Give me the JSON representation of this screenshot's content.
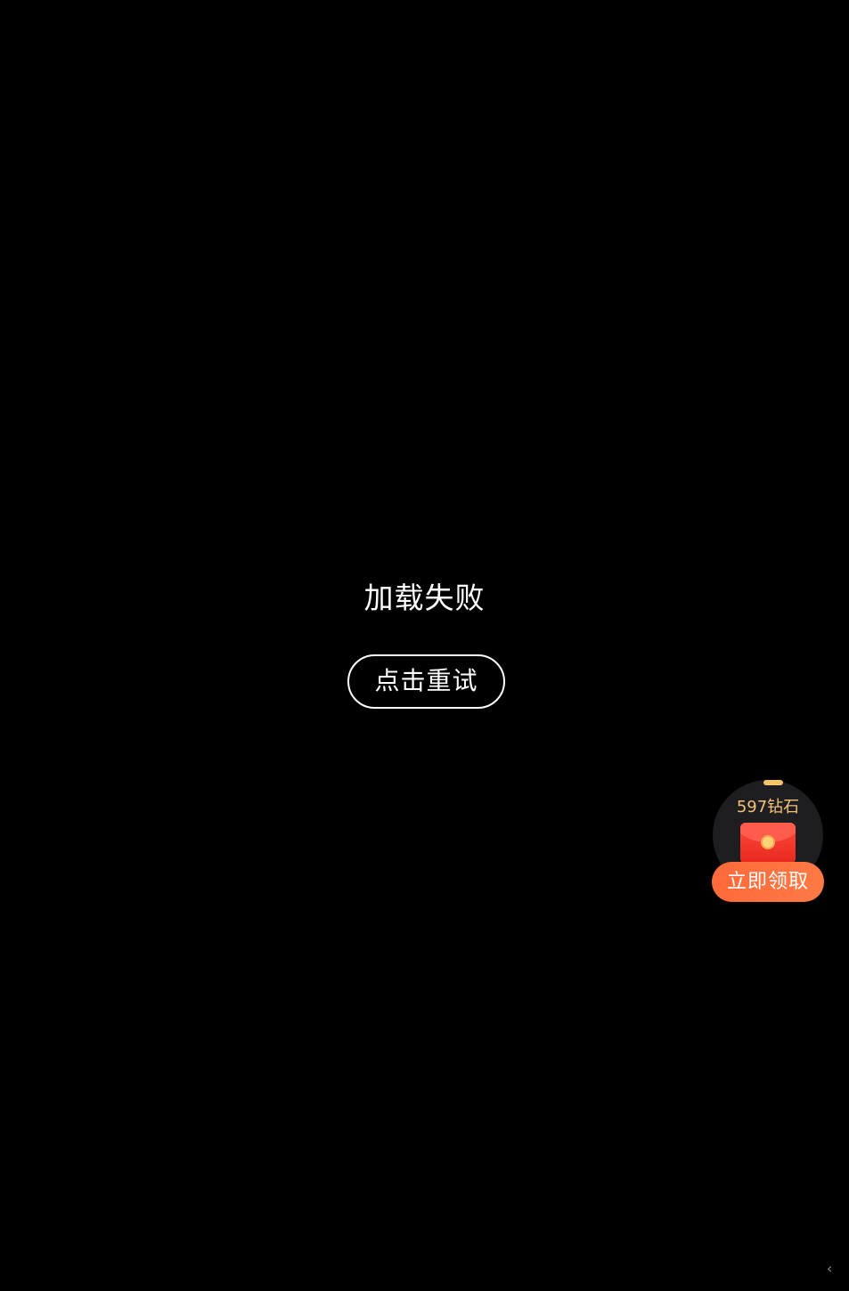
{
  "status": {
    "message": "加载失败"
  },
  "retry": {
    "label": "点击重试"
  },
  "reward": {
    "amount_text": "597钻石",
    "claim_label": "立即领取",
    "icon": "red-envelope-icon",
    "colors": {
      "accent": "#ff6a3a",
      "amount": "#f3c27a",
      "envelope": "#e8281f"
    }
  },
  "corner": {
    "icon": "corner-mark-icon",
    "glyph": "‹"
  }
}
